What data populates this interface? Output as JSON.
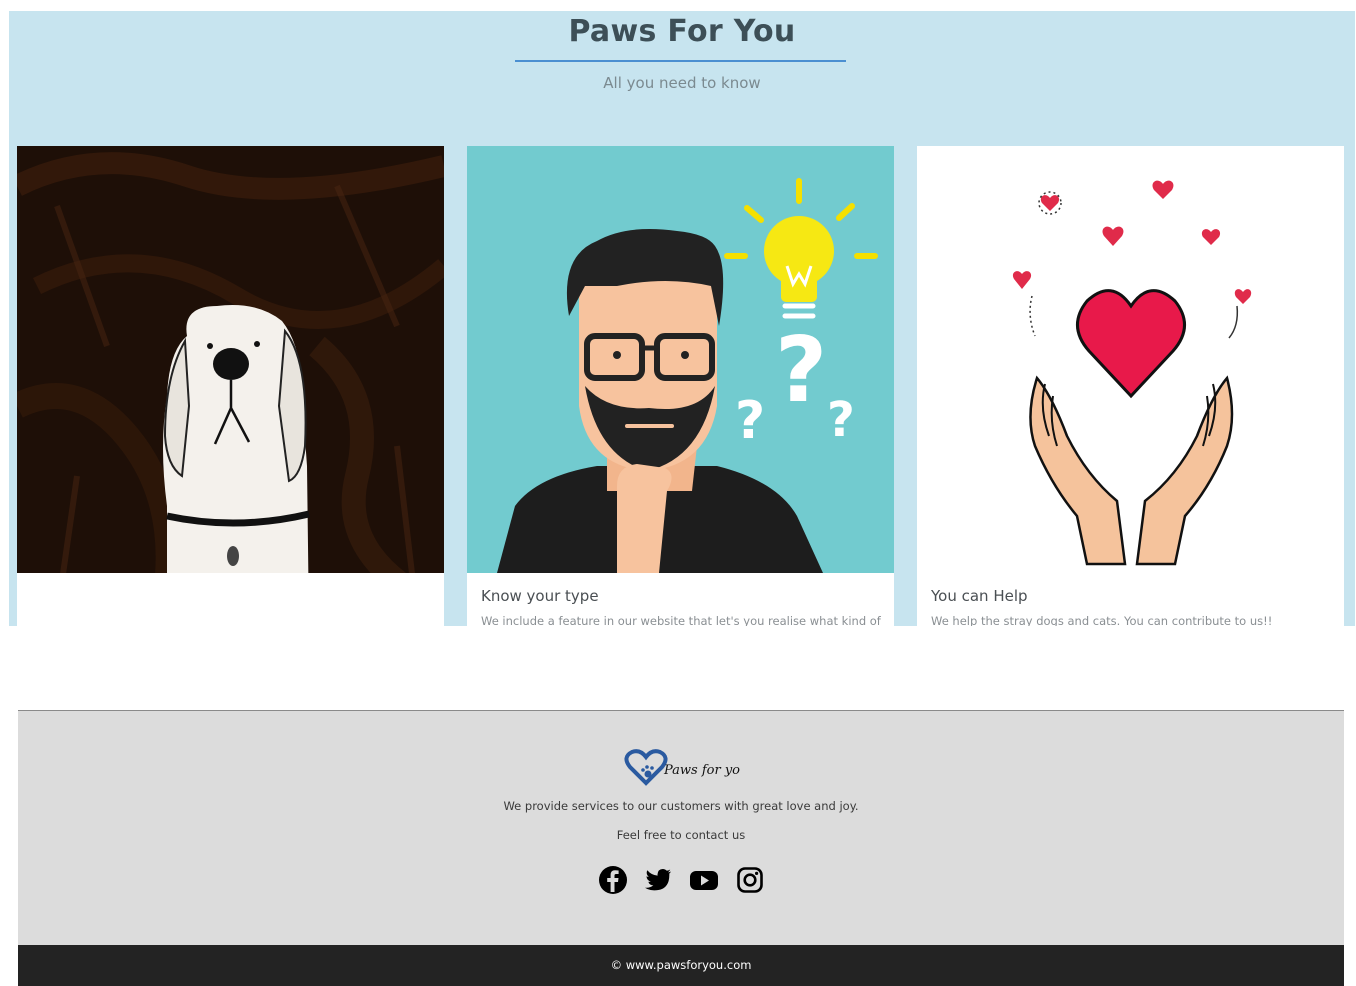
{
  "hero": {
    "title": "Paws For You",
    "subtitle": "All you need to know"
  },
  "cards": [
    {
      "image": "dog-drawing",
      "title": "",
      "text": ""
    },
    {
      "image": "thinking-man-illustration",
      "title": "Know your type",
      "text": "We include a feature in our website that let's you realise what kind of"
    },
    {
      "image": "hands-heart-illustration",
      "title": "You can Help",
      "text": "We help the stray dogs and cats. You can contribute to us!!"
    }
  ],
  "footer": {
    "logo_text": "Paws for you",
    "description": "We provide services to our customers with great love and joy.",
    "contact": "Feel free to contact us",
    "social": [
      "facebook-icon",
      "twitter-icon",
      "youtube-icon",
      "instagram-icon"
    ],
    "copyright": "© www.pawsforyou.com"
  },
  "colors": {
    "hero_bg": "#c7e4ef",
    "accent_rule": "#4b8fd1",
    "footer_bg": "#dcdcdc",
    "bottom_bar": "#232323"
  }
}
